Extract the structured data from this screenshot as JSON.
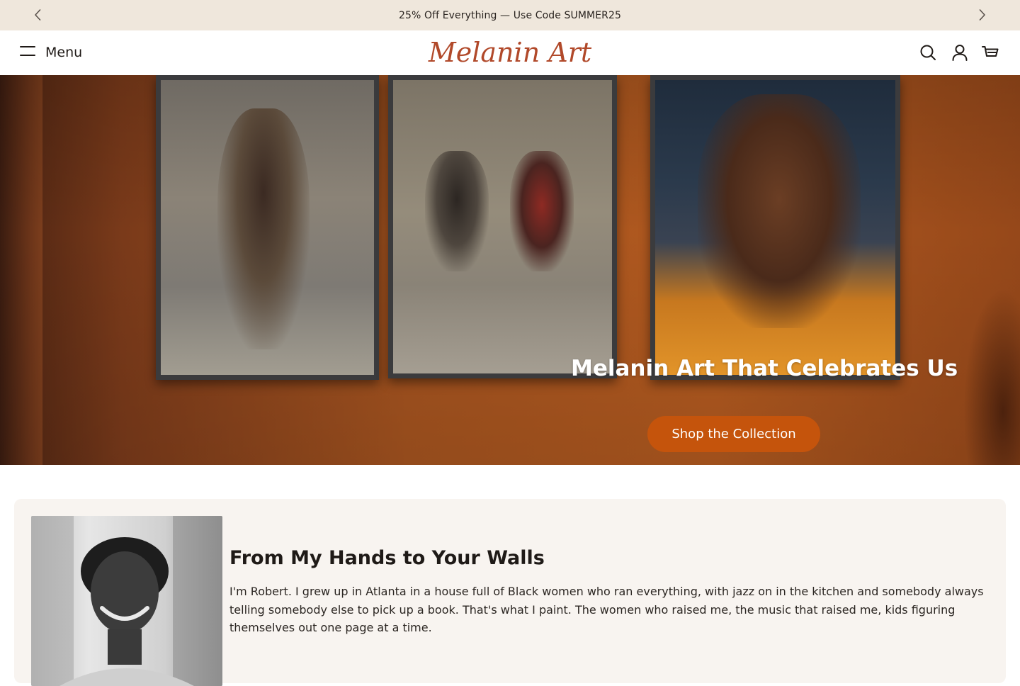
{
  "announcement": {
    "text": "25% Off Everything — Use Code SUMMER25",
    "prev_icon": "chevron-left-icon",
    "next_icon": "chevron-right-icon"
  },
  "header": {
    "menu_label": "Menu",
    "menu_icon": "hamburger-icon",
    "logo_text": "Melanin Art",
    "icons": [
      "search-icon",
      "account-icon",
      "cart-icon"
    ]
  },
  "hero": {
    "title": "Melanin Art That Celebrates Us",
    "cta_label": "Shop the Collection"
  },
  "about": {
    "title": "From My Hands to Your Walls",
    "body": "I'm Robert. I grew up in Atlanta in a house full of Black women who ran everything, with jazz on in the kitchen and somebody always telling somebody else to pick up a book. That's what I paint. The women who raised me, the music that raised me, kids figuring themselves out one page at a time."
  },
  "colors": {
    "announcement_bg": "#efe7dc",
    "brand": "#b1492a",
    "cta": "#c5540c",
    "about_bg": "#f8f4f0"
  }
}
